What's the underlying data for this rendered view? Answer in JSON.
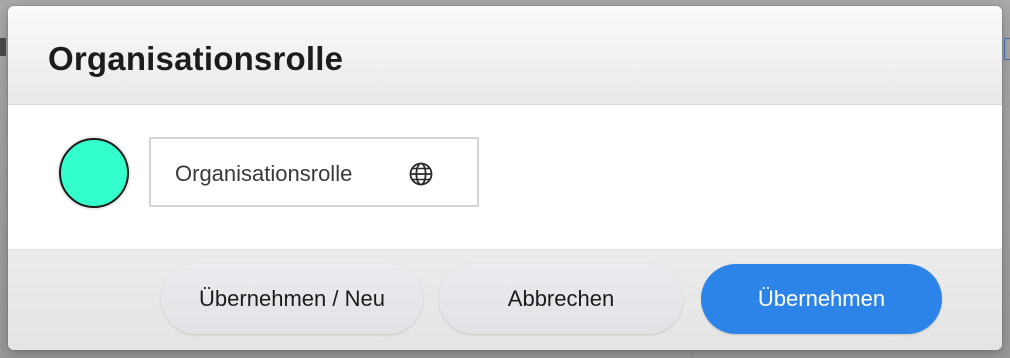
{
  "dialog": {
    "title": "Organisationsrolle"
  },
  "role": {
    "color": "#33ffcc",
    "name_value": "Organisationsrolle",
    "translate_icon": "globe-icon"
  },
  "footer": {
    "apply_new_label": "Übernehmen / Neu",
    "cancel_label": "Abbrechen",
    "apply_label": "Übernehmen",
    "primary_color": "#2d84e8"
  }
}
